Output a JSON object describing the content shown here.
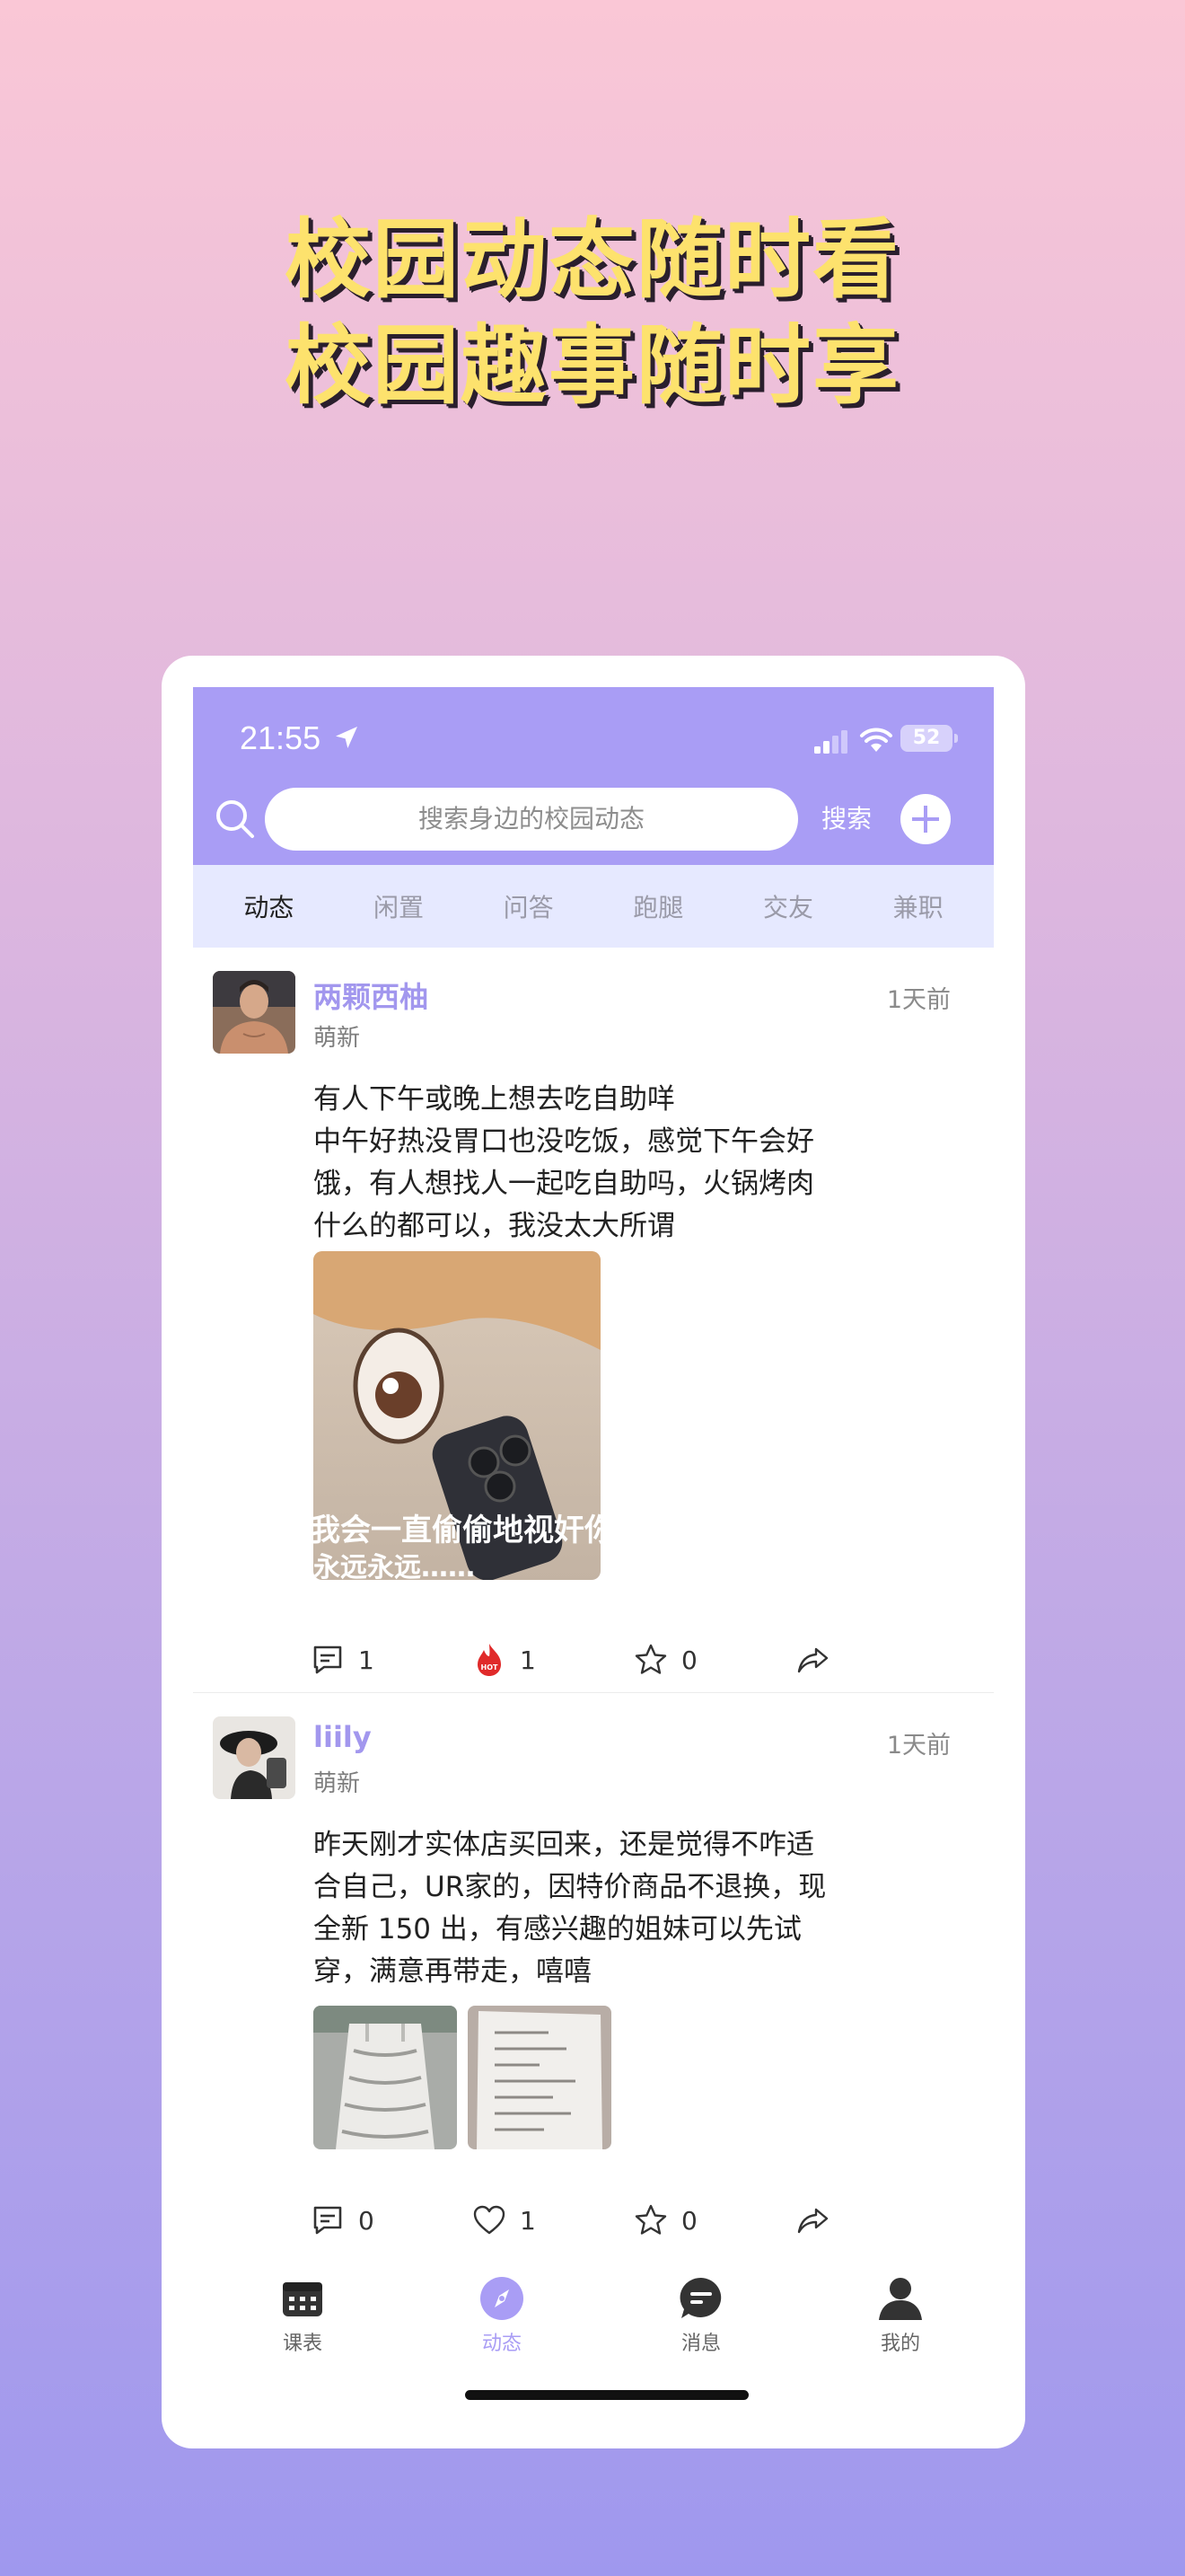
{
  "promo": {
    "line1": "校园动态随时看",
    "line2": "校园趣事随时享"
  },
  "status_bar": {
    "time": "21:55",
    "battery": "52"
  },
  "search": {
    "placeholder": "搜索身边的校园动态",
    "button_label": "搜索"
  },
  "category_tabs": [
    {
      "label": "动态",
      "active": true
    },
    {
      "label": "闲置",
      "active": false
    },
    {
      "label": "问答",
      "active": false
    },
    {
      "label": "跑腿",
      "active": false
    },
    {
      "label": "交友",
      "active": false
    },
    {
      "label": "兼职",
      "active": false
    }
  ],
  "posts": [
    {
      "username": "两颗西柚",
      "level": "萌新",
      "time": "1天前",
      "lines": [
        "有人下午或晚上想去吃自助咩",
        "中午好热没胃口也没吃饭，感觉下午会好",
        "饿，有人想找人一起吃自助吗，火锅烤肉",
        "什么的都可以，我没太大所谓"
      ],
      "image_caption": "我会一直偷偷地视奸你",
      "image_caption_2": "永远永远……",
      "comments": "1",
      "likes": "1",
      "favorites": "0"
    },
    {
      "username": "liily",
      "level": "萌新",
      "time": "1天前",
      "lines": [
        "昨天刚才实体店买回来，还是觉得不咋适",
        "合自己，UR家的，因特价商品不退换，现",
        "全新 150 出，有感兴趣的姐妹可以先试",
        "穿，满意再带走，嘻嘻"
      ],
      "comments": "0",
      "likes": "1",
      "favorites": "0"
    }
  ],
  "bottom_nav": [
    {
      "label": "课表",
      "icon": "calendar-icon",
      "active": false
    },
    {
      "label": "动态",
      "icon": "compass-icon",
      "active": true
    },
    {
      "label": "消息",
      "icon": "message-icon",
      "active": false
    },
    {
      "label": "我的",
      "icon": "person-icon",
      "active": false
    }
  ],
  "colors": {
    "accent": "#a99df5",
    "tabs_bg": "#e6e9ff",
    "username": "#a297ee",
    "headline": "#fde26d",
    "hot": "#e02a2a"
  }
}
